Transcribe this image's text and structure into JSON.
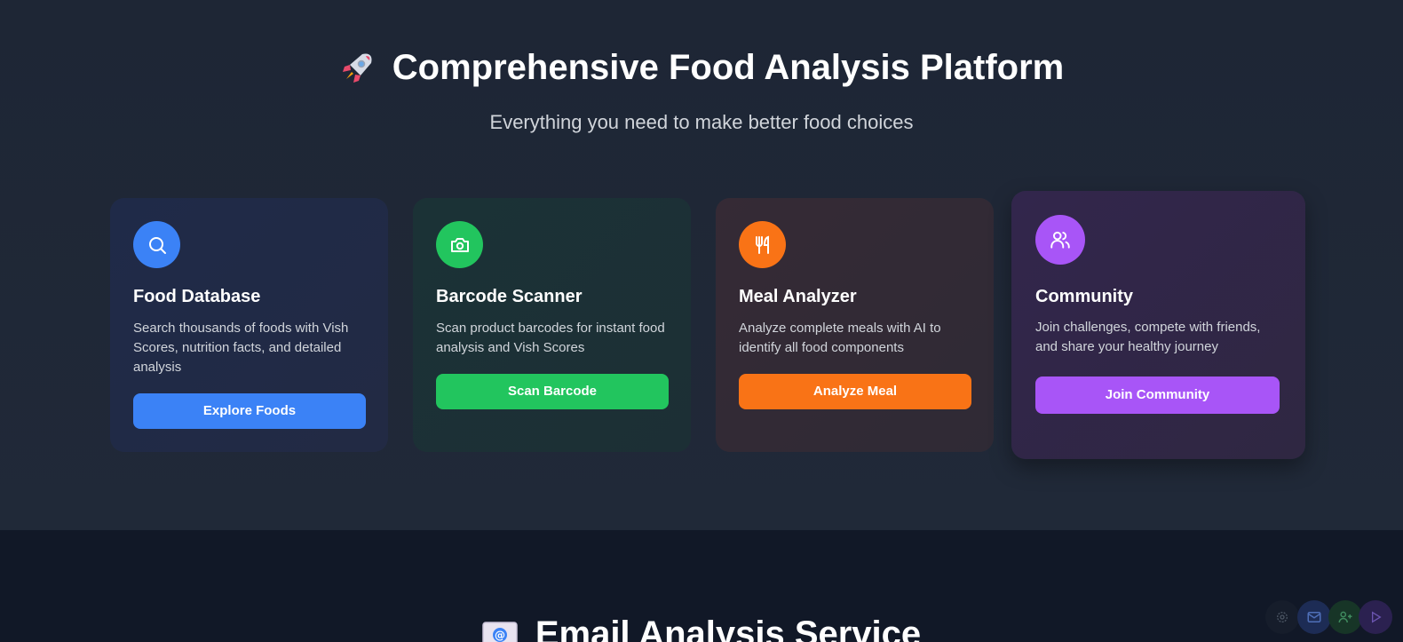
{
  "hero": {
    "title": "Comprehensive Food Analysis Platform",
    "title_icon": "rocket-icon",
    "subtitle": "Everything you need to make better food choices"
  },
  "cards": [
    {
      "title": "Food Database",
      "icon": "search-icon",
      "description": "Search thousands of foods with Vish Scores, nutrition facts, and detailed analysis",
      "button": "Explore Foods",
      "color": "#3b82f6"
    },
    {
      "title": "Barcode Scanner",
      "icon": "camera-icon",
      "description": "Scan product barcodes for instant food analysis and Vish Scores",
      "button": "Scan Barcode",
      "color": "#22c55e"
    },
    {
      "title": "Meal Analyzer",
      "icon": "utensils-icon",
      "description": "Analyze complete meals with AI to identify all food components",
      "button": "Analyze Meal",
      "color": "#f97316"
    },
    {
      "title": "Community",
      "icon": "users-icon",
      "description": "Join challenges, compete with friends, and share your healthy journey",
      "button": "Join Community",
      "color": "#a855f7"
    }
  ],
  "email_section": {
    "title": "Email Analysis Service",
    "title_icon": "email-icon"
  },
  "floating_buttons": [
    "gear-icon",
    "mail-icon",
    "user-plus-icon",
    "play-icon"
  ]
}
